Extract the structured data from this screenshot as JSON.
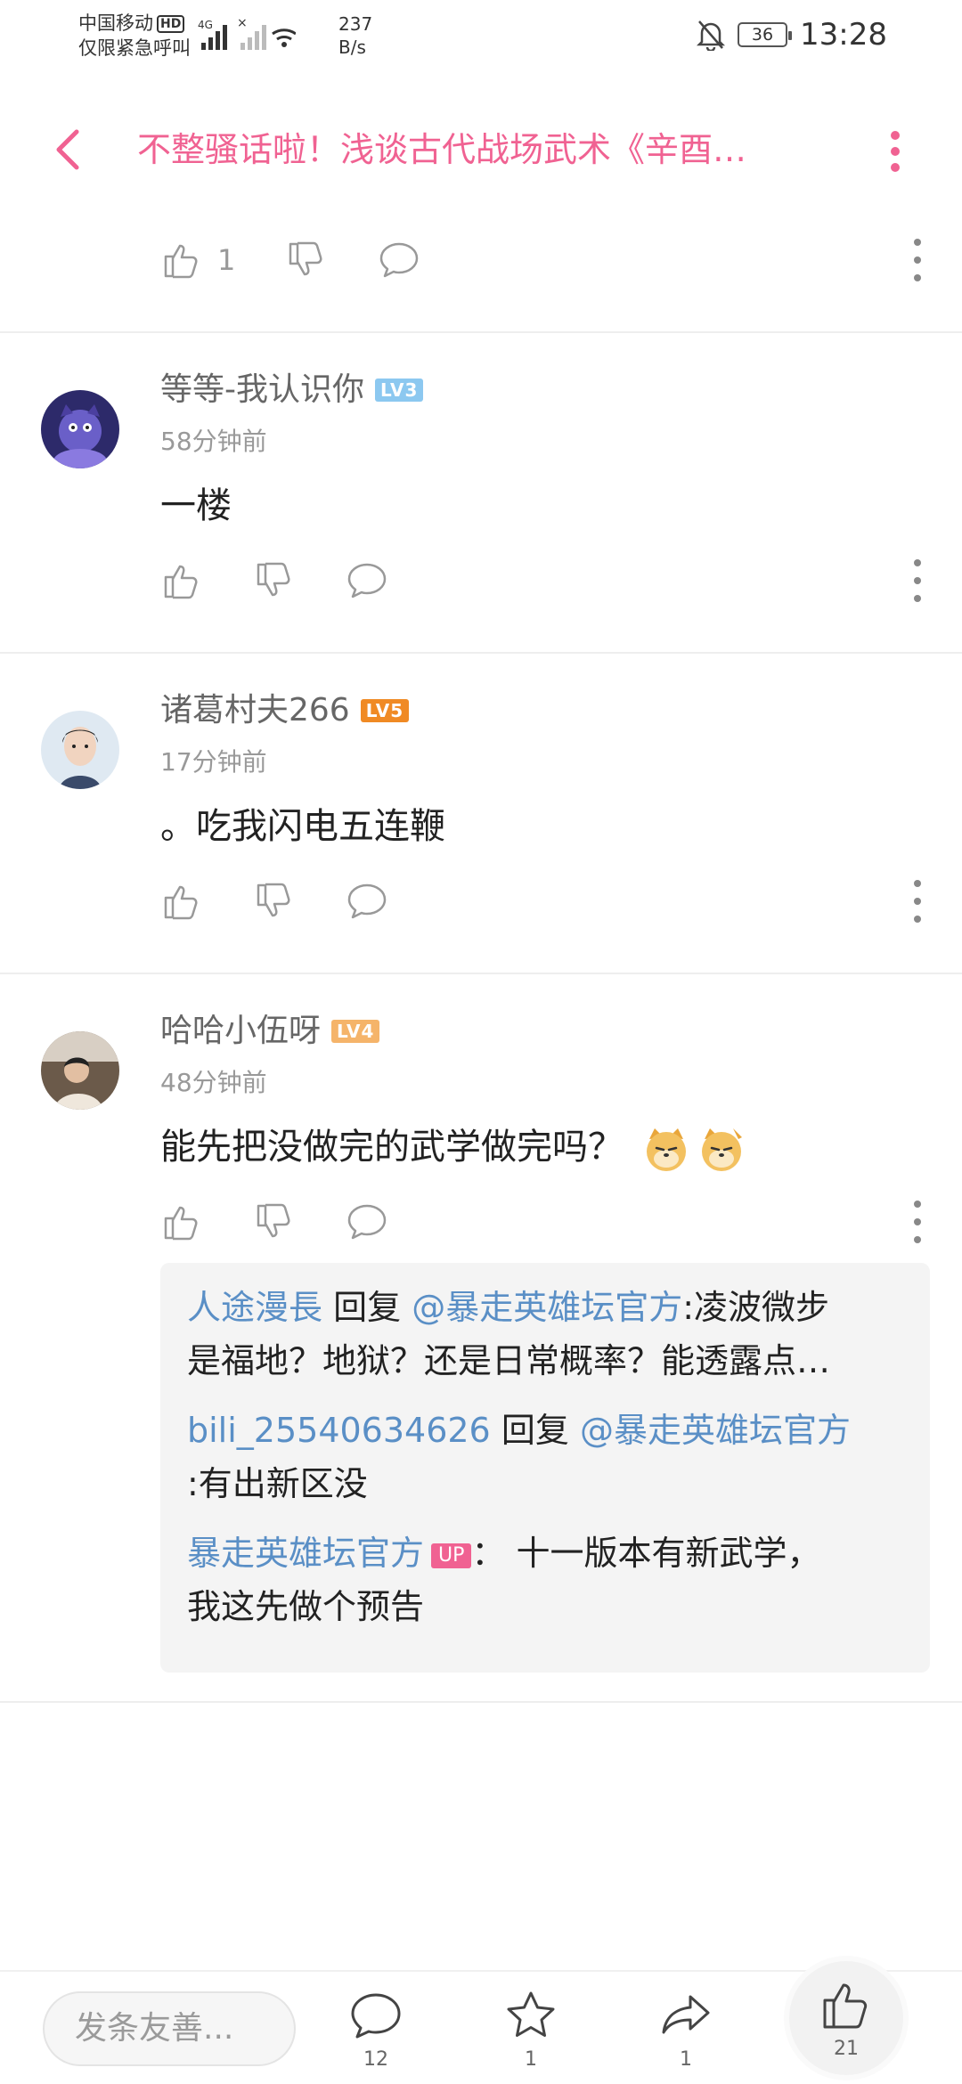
{
  "status_bar": {
    "carrier_line1": "中国移动",
    "hd": "HD",
    "carrier_line2": "仅限紧急呼叫",
    "network": "4G",
    "speed_value": "237",
    "speed_unit": "B/s",
    "battery": "36",
    "time": "13:28"
  },
  "header": {
    "title": "不整骚话啦！浅谈古代战场武术《辛酉…",
    "back_icon": "chevron-left-icon",
    "more_icon": "vertical-dots-icon"
  },
  "top_actions": {
    "like_count": "1"
  },
  "comments": [
    {
      "username": "等等-我认识你",
      "level": "LV3",
      "level_color": "#8cc8f0",
      "time": "58分钟前",
      "text": "一楼"
    },
    {
      "username": "诸葛村夫266",
      "level": "LV5",
      "level_color": "#f08a24",
      "time": "17分钟前",
      "text": "。吃我闪电五连鞭"
    },
    {
      "username": "哈哈小伍呀",
      "level": "LV4",
      "level_color": "#f5b46a",
      "time": "48分钟前",
      "text": "能先把没做完的武学做完吗？"
    }
  ],
  "replies": [
    {
      "user": "人途漫長",
      "reply_word": "回复",
      "target": "@暴走英雄坛官方",
      "text_line1": ":凌波微步",
      "text_line2": "是福地？地狱？还是日常概率？能透露点…"
    },
    {
      "user": "bili_25540634626",
      "reply_word": "回复",
      "target": "@暴走英雄坛官方",
      "text_line1": "",
      "text_line2": ":有出新区没"
    },
    {
      "user": "暴走英雄坛官方",
      "up_tag": "UP",
      "text_line1": "：  十一版本有新武学，",
      "text_line2": "我这先做个预告"
    }
  ],
  "bottom_bar": {
    "input_placeholder": "发条友善...",
    "comment_count": "12",
    "favorite_count": "1",
    "share_count": "1",
    "like_count": "21"
  },
  "colors": {
    "accent": "#f06292",
    "link": "#5a8fc6"
  }
}
